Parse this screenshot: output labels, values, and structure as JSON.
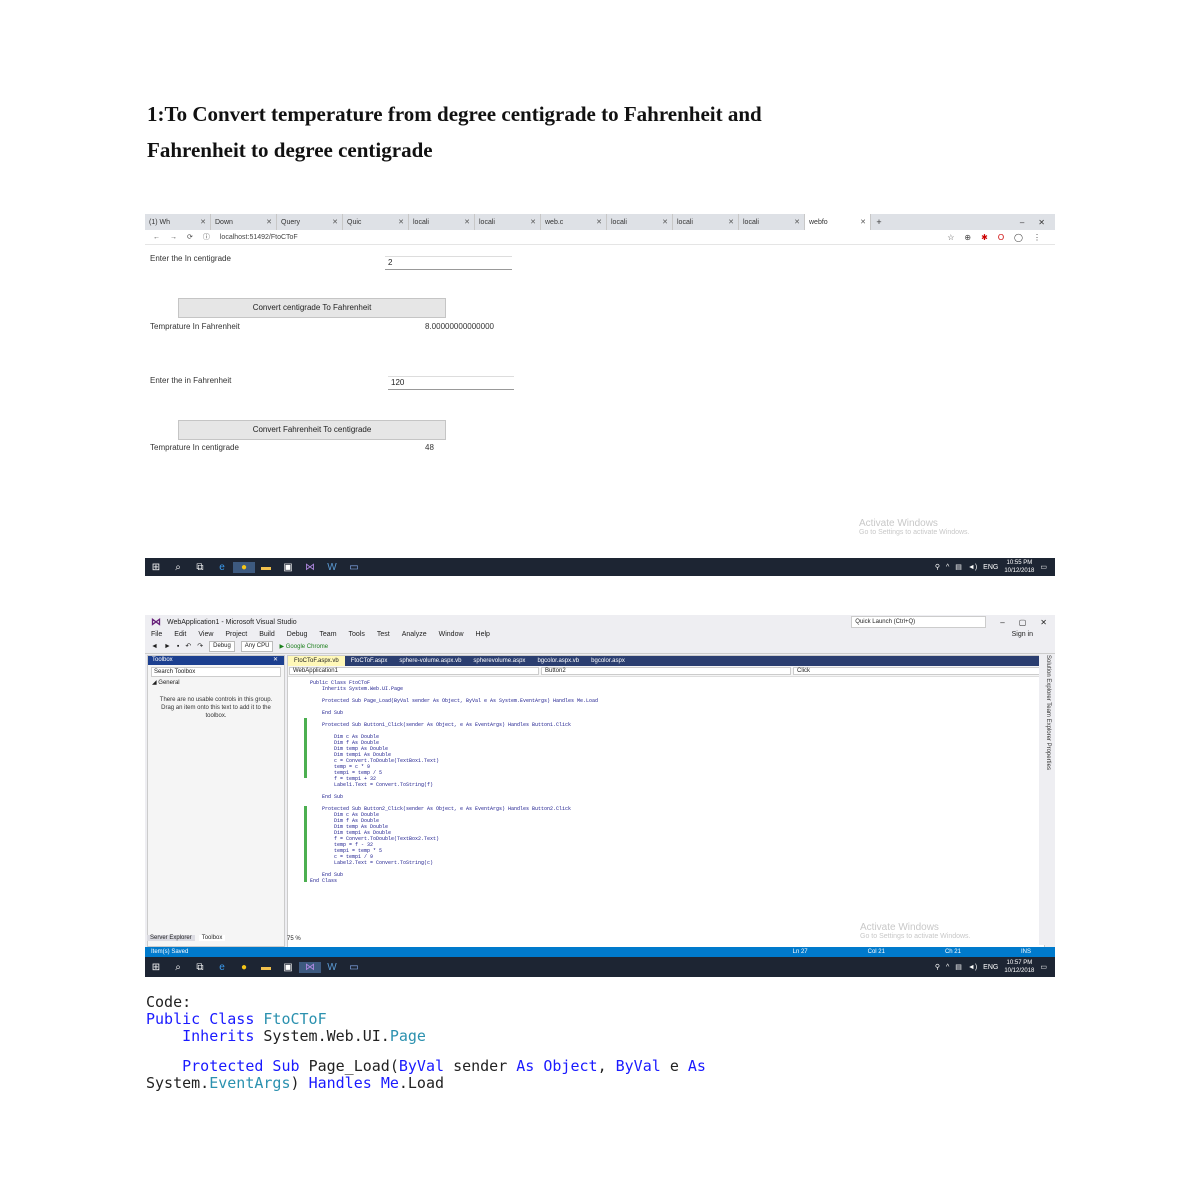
{
  "heading": {
    "line1": "1:To Convert temperature from degree centigrade to Fahrenheit and",
    "line2": "Fahrenheit to degree centigrade"
  },
  "browser": {
    "tabs": [
      "(1) Wh",
      "Down",
      "Query",
      "Quic",
      "locali",
      "locali",
      "web.c",
      "locali",
      "locali",
      "locali",
      "webfo"
    ],
    "url": "localhost:51492/FtoCToF",
    "form": {
      "label_c": "Enter the In centigrade",
      "input_c": "2",
      "button_c": "Convert centigrade To Fahrenheit",
      "result_label_f": "Temprature In Fahrenheit",
      "result_f": "8.00000000000000",
      "label_f": "Enter the in Fahrenheit",
      "input_f": "120",
      "button_f": "Convert Fahrenheit To centigrade",
      "result_label_c": "Temprature In centigrade",
      "result_c": "48"
    },
    "activate": {
      "title": "Activate Windows",
      "sub": "Go to Settings to activate Windows."
    },
    "clock": {
      "time": "10:55 PM",
      "date": "10/12/2018"
    },
    "lang": "ENG"
  },
  "vs": {
    "title": "WebApplication1 - Microsoft Visual Studio",
    "quick_launch": "Quick Launch (Ctrl+Q)",
    "menu": [
      "File",
      "Edit",
      "View",
      "Project",
      "Build",
      "Debug",
      "Team",
      "Tools",
      "Test",
      "Analyze",
      "Window",
      "Help"
    ],
    "sign_in": "Sign in",
    "config": "Debug",
    "platform": "Any CPU",
    "run": "Google Chrome",
    "toolbox": {
      "title": "Toolbox",
      "search": "Search Toolbox",
      "general": "General",
      "message": "There are no usable controls in this group. Drag an item onto this text to add it to the toolbox."
    },
    "doc_tabs": [
      "FtoCToF.aspx.vb",
      "FtoCToF.aspx",
      "sphere-volume.aspx.vb",
      "spherevolume.aspx",
      "bgcolor.aspx.vb",
      "bgcolor.aspx"
    ],
    "nav": {
      "project": "WebApplication1",
      "object": "Button2",
      "event": "Click"
    },
    "code": "Public Class FtoCToF\n    Inherits System.Web.UI.Page\n\n    Protected Sub Page_Load(ByVal sender As Object, ByVal e As System.EventArgs) Handles Me.Load\n\n    End Sub\n\n    Protected Sub Button1_Click(sender As Object, e As EventArgs) Handles Button1.Click\n\n        Dim c As Double\n        Dim f As Double\n        Dim temp As Double\n        Dim temp1 As Double\n        c = Convert.ToDouble(TextBox1.Text)\n        temp = c * 9\n        temp1 = temp / 5\n        f = temp1 + 32\n        Label1.Text = Convert.ToString(f)\n\n    End Sub\n\n    Protected Sub Button2_Click(sender As Object, e As EventArgs) Handles Button2.Click\n        Dim c As Double\n        Dim f As Double\n        Dim temp As Double\n        Dim temp1 As Double\n        f = Convert.ToDouble(TextBox2.Text)\n        temp = f - 32\n        temp1 = temp * 5\n        c = temp1 / 9\n        Label2.Text = Convert.ToString(c)\n\n    End Sub\nEnd Class",
    "zoom": "75 %",
    "pane_tabs": [
      "Server Explorer",
      "Toolbox"
    ],
    "side_panes": "Solution Explorer  Team Explorer  Properties",
    "status": {
      "left": "Item(s) Saved",
      "ln": "Ln 27",
      "col": "Col 21",
      "ch": "Ch 21",
      "ins": "INS"
    },
    "activate": {
      "title": "Activate Windows",
      "sub": "Go to Settings to activate Windows."
    },
    "clock": {
      "time": "10:57 PM",
      "date": "10/12/2018"
    }
  },
  "listing": {
    "label": "Code:",
    "l1_kw": "Public Class",
    "l1_name": "FtoCToF",
    "l2_kw": "Inherits",
    "l2_ns": "System.Web.UI.",
    "l2_type": "Page",
    "l3_kw1": "Protected Sub",
    "l3_name": "Page_Load(",
    "l3_kw2": "ByVal",
    "l3_mid": "sender",
    "l3_kw3": "As",
    "l3_kw4": "Object",
    "l3_comma": ",",
    "l3_kw5": "ByVal",
    "l3_e": "e",
    "l3_kw6": "As",
    "l4_ns": "System.",
    "l4_type": "EventArgs",
    "l4_paren": ")",
    "l4_kw1": "Handles",
    "l4_kw2": "Me",
    "l4_end": ".Load"
  }
}
